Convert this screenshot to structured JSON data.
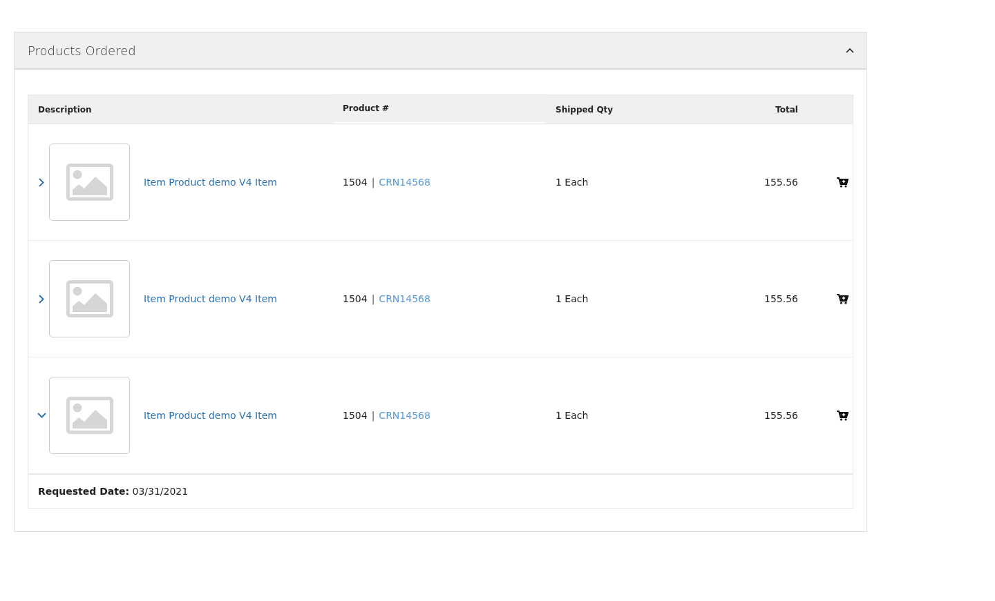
{
  "panel": {
    "title": "Products Ordered",
    "expanded": true
  },
  "table": {
    "columns": [
      "Description",
      "Product #",
      "Shipped Qty",
      "Total"
    ],
    "rows": [
      {
        "expanded": false,
        "description": "Item Product demo V4 Item",
        "product_number": "1504",
        "separator": "|",
        "product_code": "CRN14568",
        "shipped_qty": "1 Each",
        "total": "155.56"
      },
      {
        "expanded": false,
        "description": "Item Product demo V4 Item",
        "product_number": "1504",
        "separator": "|",
        "product_code": "CRN14568",
        "shipped_qty": "1 Each",
        "total": "155.56"
      },
      {
        "expanded": true,
        "description": "Item Product demo V4 Item",
        "product_number": "1504",
        "separator": "|",
        "product_code": "CRN14568",
        "shipped_qty": "1 Each",
        "total": "155.56"
      }
    ]
  },
  "requested_date": "**Requested Date:** 03/31/2021"
}
